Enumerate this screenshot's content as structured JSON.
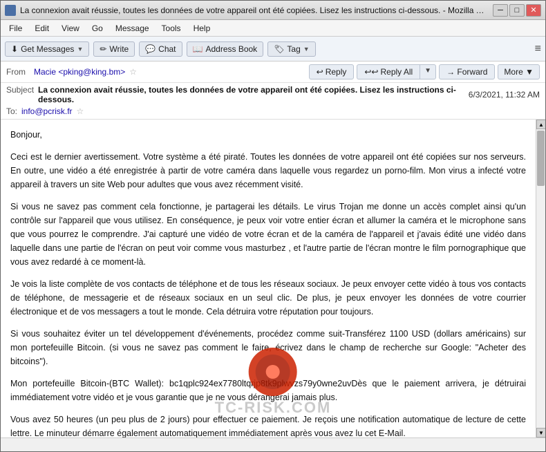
{
  "window": {
    "title": "La connexion avait réussie, toutes les données de votre appareil ont été copiées. Lisez les instructions ci-dessous. - Mozilla Thu...",
    "icon_label": "thunderbird-icon"
  },
  "window_controls": {
    "minimize": "─",
    "maximize": "□",
    "close": "✕"
  },
  "menu": {
    "items": [
      "File",
      "Edit",
      "View",
      "Go",
      "Message",
      "Tools",
      "Help"
    ]
  },
  "toolbar": {
    "get_messages_label": "Get Messages",
    "write_label": "Write",
    "chat_label": "Chat",
    "address_book_label": "Address Book",
    "tag_label": "Tag"
  },
  "email_header": {
    "from_label": "From",
    "from_value": "Macie <pking@king.bm>",
    "reply_label": "Reply",
    "reply_all_label": "Reply All",
    "forward_label": "→ Forward",
    "more_label": "More",
    "subject_label": "Subject",
    "subject_value": "La connexion avait réussie, toutes les données de votre appareil ont été copiées. Lisez les instructions ci-dessous.",
    "date_value": "6/3/2021, 11:32 AM",
    "to_label": "To",
    "to_value": "info@pcrisk.fr"
  },
  "email_body": {
    "paragraphs": [
      "Bonjour,",
      "Ceci est le dernier avertissement. Votre système a été piraté. Toutes les données de votre appareil ont été copiées sur nos serveurs. En outre, une vidéo a été enregistrée à partir de votre caméra dans laquelle vous regardez un porno-film. Mon virus a infecté votre appareil à travers un site Web pour adultes que vous avez récemment visité.",
      "Si vous ne savez pas comment cela fonctionne, je partagerai les détails. Le virus Trojan me donne un accès complet ainsi qu'un contrôle sur l'appareil que vous utilisez. En conséquence, je peux voir votre entier écran et allumer la caméra et le microphone sans que vous pourrez le comprendre. J'ai capturé une vidéo de votre écran et de la caméra de l'appareil et j'avais édité une vidéo dans laquelle dans une partie de l'écran on peut voir comme vous masturbez , et l'autre partie de l'écran montre le film pornographique que vous avez redardé à ce moment-là.",
      "Je vois la liste complète de vos contacts de téléphone et de tous les réseaux sociaux. Je peux envoyer cette vidéo à tous vos contacts de téléphone, de messagerie et de réseaux sociaux en un seul clic. De plus, je peux envoyer les données de votre courrier électronique et de vos messagers a tout le monde. Cela détruira votre réputation pour toujours.",
      "Si vous souhaitez éviter un tel développement d'événements, procédez comme suit-Transférez 1100 USD (dollars américains) sur mon portefeuille Bitcoin. (si vous ne savez pas comment le faire, écrivez dans le champ de recherche sur Google: \"Acheter des bitcoins\").",
      "Mon portefeuille Bitcoin-(BTC Wallet): bc1qplc924ex7780ltqrjp8tk9plwvzs79y0wne2uvDès que le paiement arrivera, je détruirai immédiatement votre vidéo et je vous garantie que je ne vous dérangerai jamais plus.",
      "Vous avez 50 heures (un peu plus de 2 jours) pour effectuer ce paiement. Je reçois une notification automatique de lecture de cette lettre. Le minuteur démarre également automatiquement immédiatement après vous avez lu cet E-Mail."
    ]
  },
  "watermark": {
    "site_text": "TC-risk.com"
  }
}
